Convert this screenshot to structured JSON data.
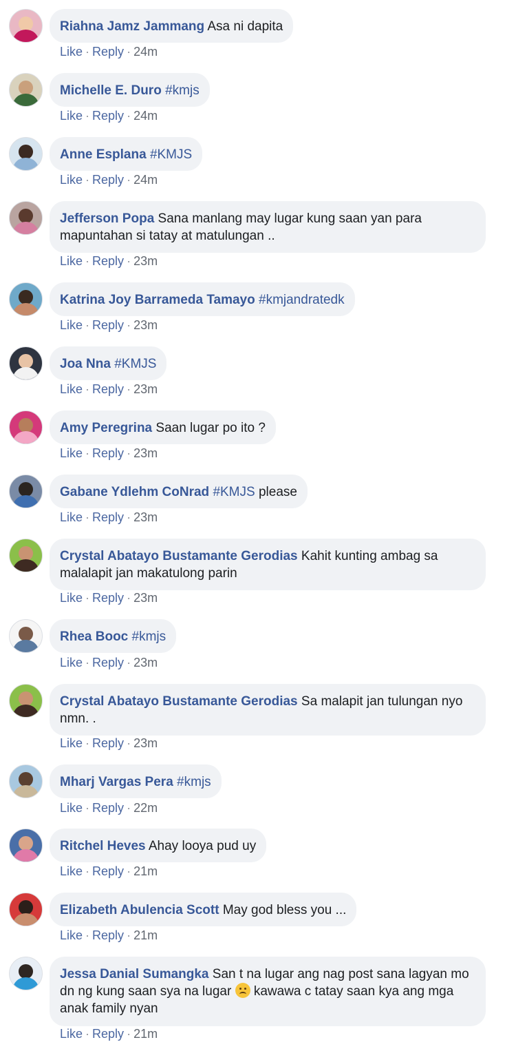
{
  "actions": {
    "like": "Like",
    "reply": "Reply",
    "separator": "·"
  },
  "comments": [
    {
      "name": "Riahna Jamz Jammang",
      "text": "Asa ni dapita",
      "time": "24m"
    },
    {
      "name": "Michelle E. Duro",
      "text": "#kmjs",
      "time": "24m"
    },
    {
      "name": "Anne Esplana",
      "text": "#KMJS",
      "time": "24m"
    },
    {
      "name": "Jefferson Popa",
      "text": "Sana manlang may lugar kung saan yan para mapuntahan si tatay at matulungan ..",
      "time": "23m"
    },
    {
      "name": "Katrina Joy Barrameda Tamayo",
      "text": "#kmjandratedk",
      "time": "23m"
    },
    {
      "name": "Joa Nna",
      "text": "#KMJS",
      "time": "23m"
    },
    {
      "name": "Amy Peregrina",
      "text": "Saan lugar po ito ?",
      "time": "23m"
    },
    {
      "name": "Gabane Ydlehm CoNrad",
      "text": "#KMJS",
      "text2": "please",
      "time": "23m"
    },
    {
      "name": "Crystal Abatayo Bustamante Gerodias",
      "text": "Kahit kunting ambag sa malalapit jan makatulong parin",
      "time": "23m"
    },
    {
      "name": "Rhea Booc",
      "text": "#kmjs",
      "time": "23m"
    },
    {
      "name": "Crystal Abatayo Bustamante Gerodias",
      "text": "Sa malapit jan tulungan nyo nmn. .",
      "time": "23m"
    },
    {
      "name": "Mharj Vargas Pera",
      "text": "#kmjs",
      "time": "22m"
    },
    {
      "name": "Ritchel Heves",
      "text": "Ahay looya pud uy",
      "time": "21m"
    },
    {
      "name": "Elizabeth Abulencia Scott",
      "text": "May god bless you ...",
      "time": "21m"
    },
    {
      "name": "Jessa Danial Sumangka",
      "text": "San t na lugar ang nag post sana lagyan mo dn ng kung saan sya na lugar",
      "text2": "kawawa c tatay saan kya ang mga anak family nyan",
      "emoji": "sad-face",
      "time": "21m"
    }
  ],
  "colors": {
    "name": "#385898",
    "bubble": "#f0f2f5",
    "action": "#4b67a1",
    "time": "#616770"
  }
}
